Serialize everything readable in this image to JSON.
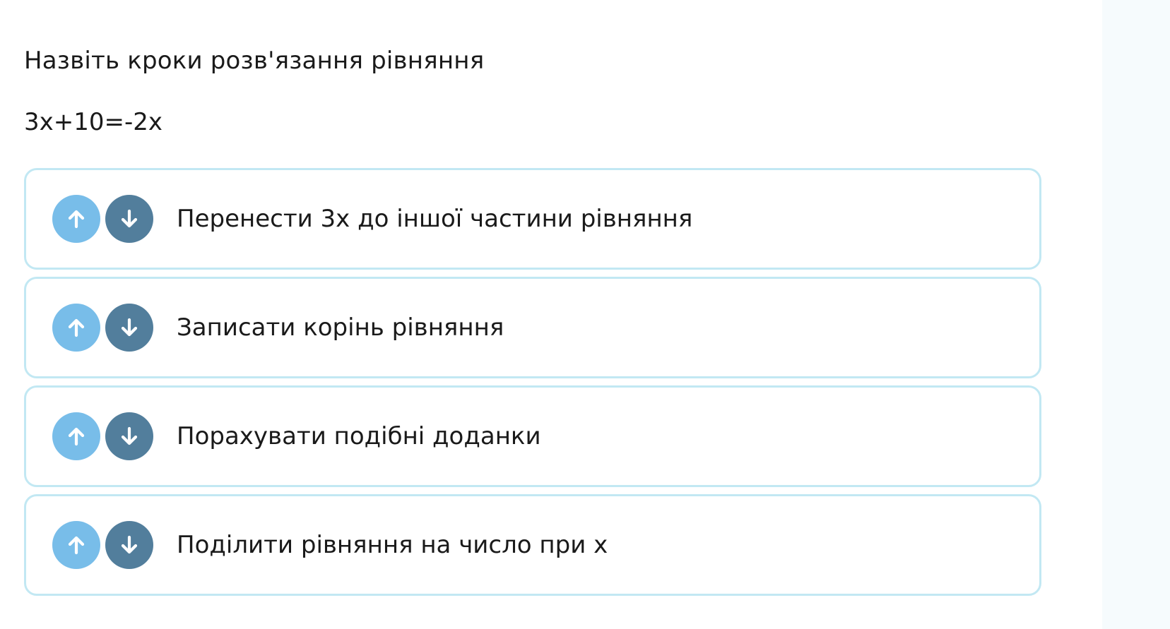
{
  "task": {
    "question": "Назвіть кроки розв'язання рівняння",
    "equation": "3x+10=-2x"
  },
  "steps": [
    {
      "label": "Перенести 3х до іншої частини рівняння"
    },
    {
      "label": "Записати корінь рівняння"
    },
    {
      "label": "Порахувати подібні доданки"
    },
    {
      "label": "Поділити рівняння на число при х"
    }
  ],
  "icons": {
    "up": "arrow-up-icon",
    "down": "arrow-down-icon"
  },
  "colors": {
    "card_border": "#c2e8f3",
    "up_button": "#78bde9",
    "down_button": "#527e9c",
    "text": "#1a1a1a"
  }
}
